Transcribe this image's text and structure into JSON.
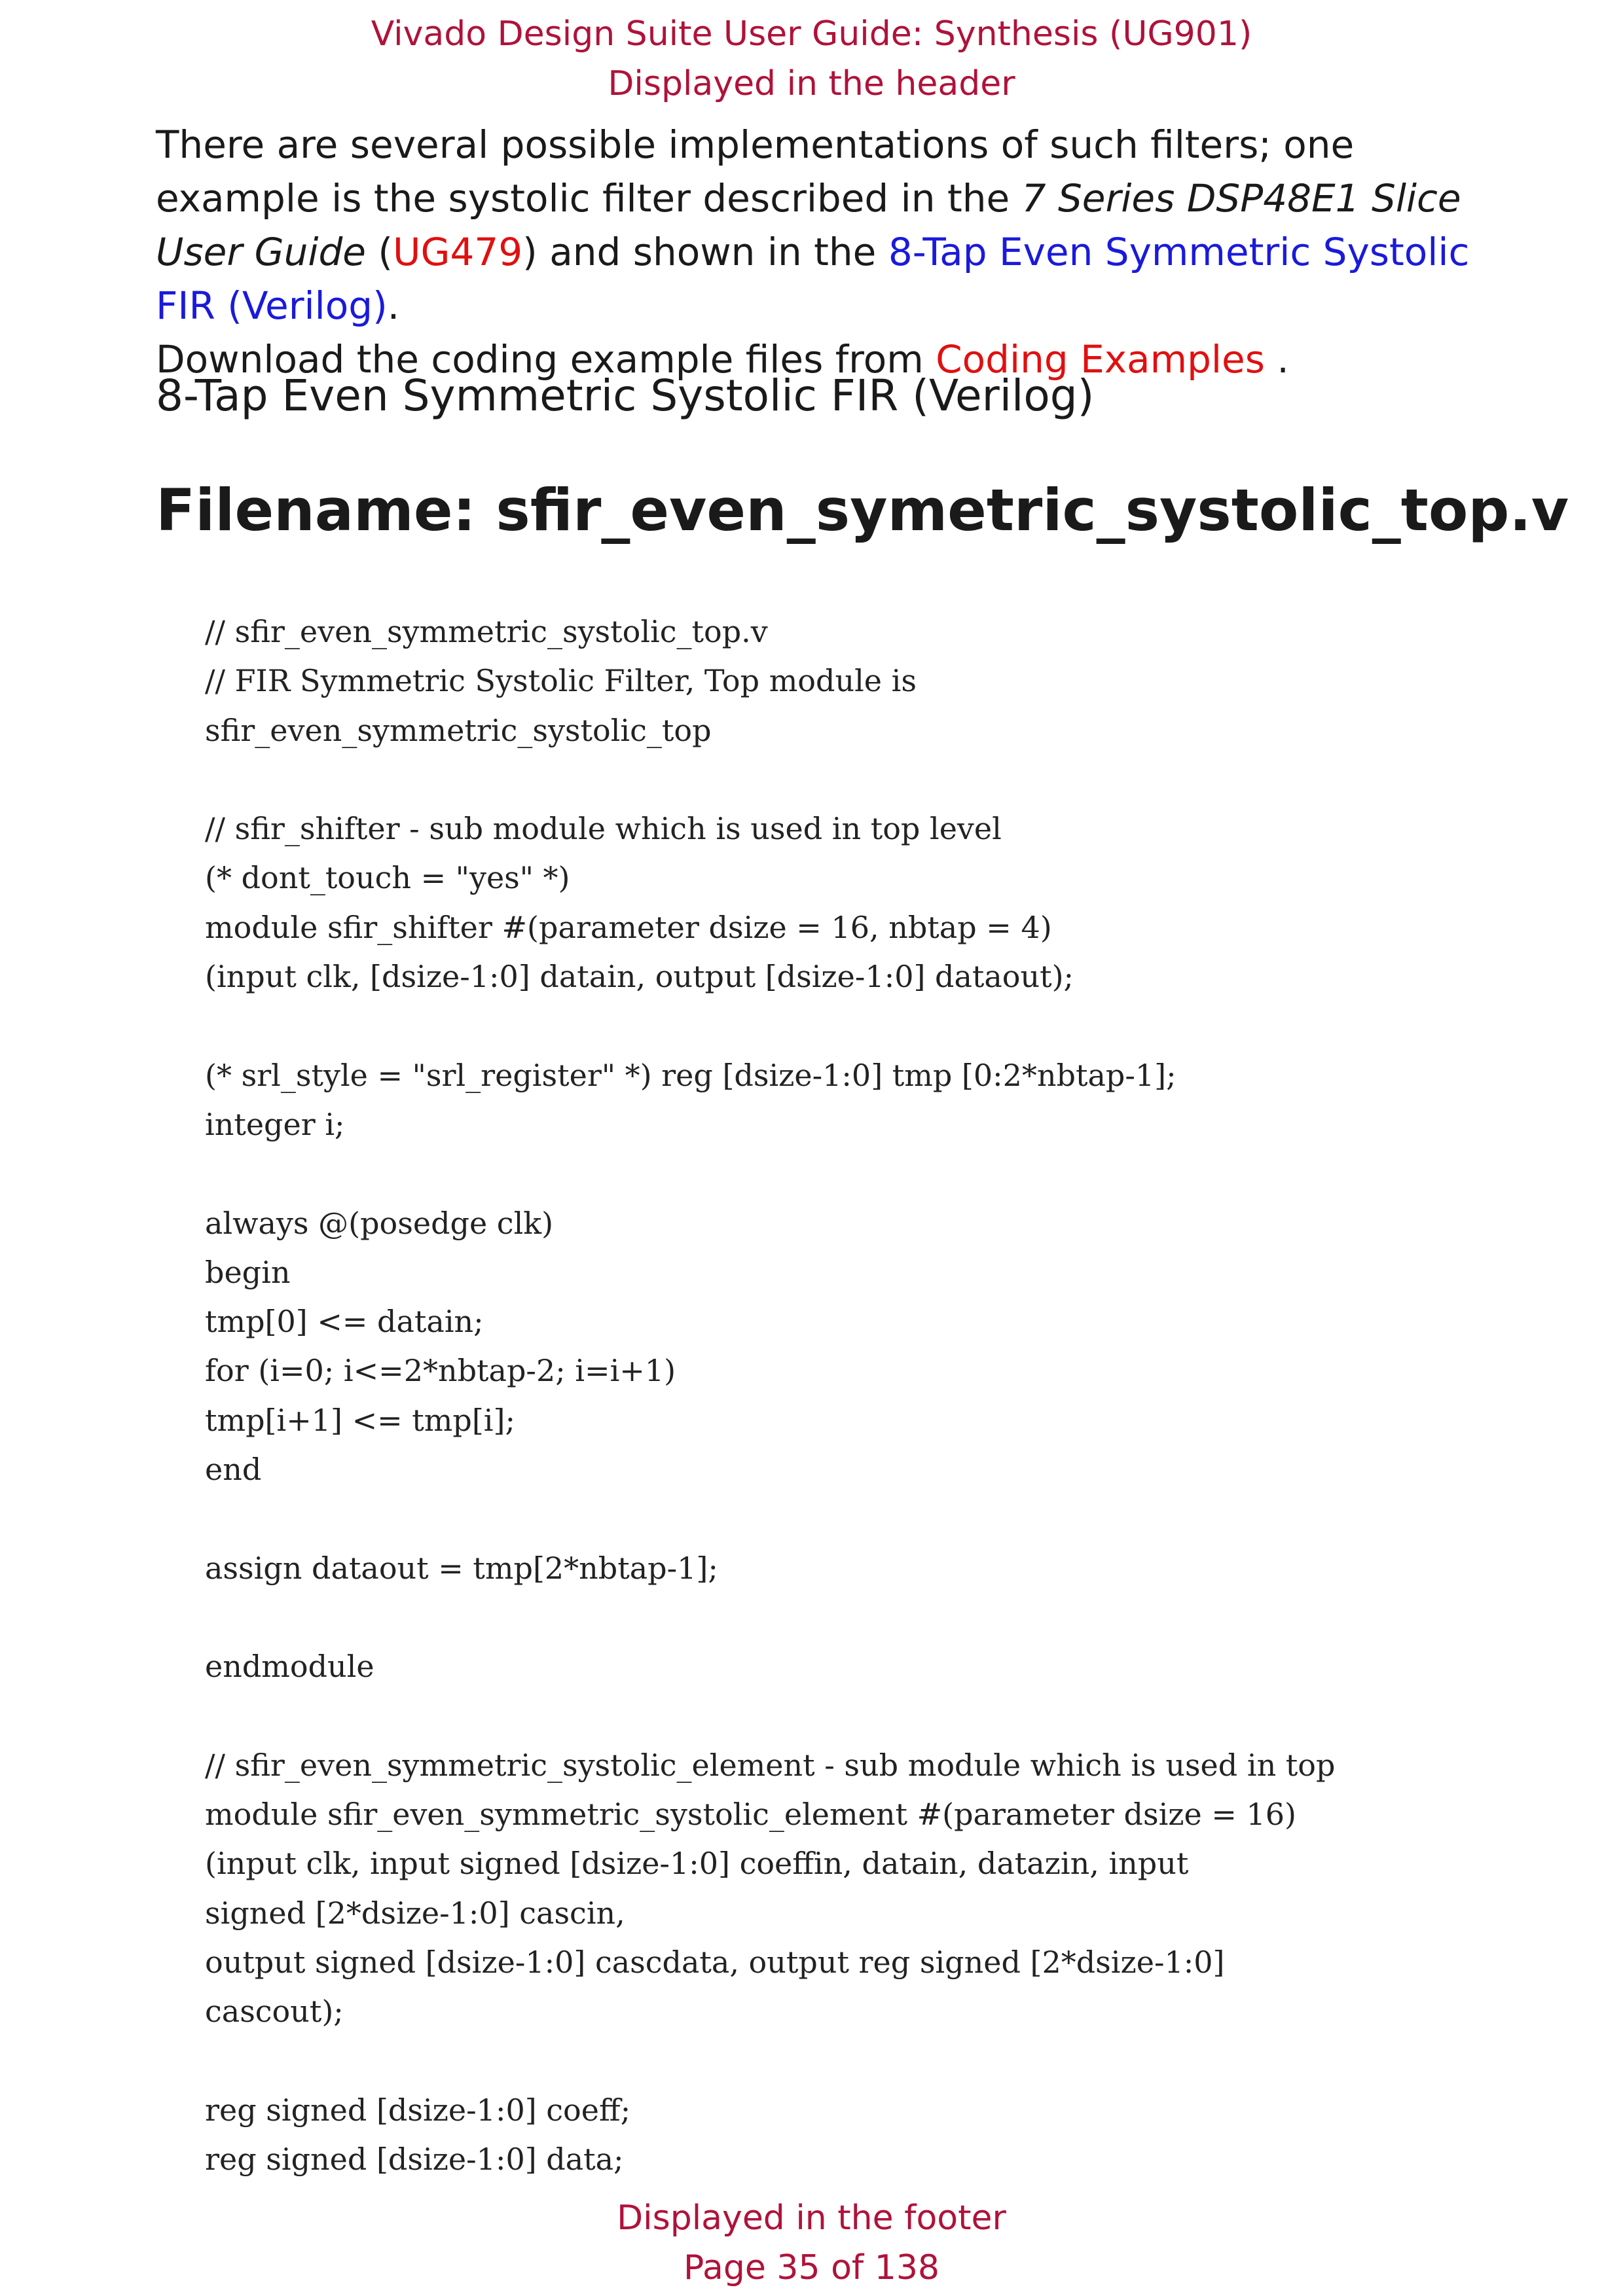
{
  "header": {
    "line1": "Vivado Design Suite User Guide: Synthesis (UG901)",
    "line2": "Displayed in the header"
  },
  "intro": {
    "p1_a": "There are several possible implementations of such filters; one example is the systolic filter described in the ",
    "p1_italic": "7 Series DSP48E1 Slice User Guide",
    "p1_b": " (",
    "p1_link_ug": "UG479",
    "p1_c": ") and shown in the ",
    "p1_link_example": "8-Tap Even Symmetric Systolic FIR (Verilog)",
    "p1_d": ".",
    "p2_a": "Download the coding example files from ",
    "p2_link": "Coding Examples",
    "p2_b": " ."
  },
  "section_heading": "8-Tap Even Symmetric Systolic FIR (Verilog)",
  "filename": "Filename: sfir_even_symetric_systolic_top.v",
  "code_lines": [
    "// sfir_even_symmetric_systolic_top.v",
    "// FIR Symmetric Systolic Filter, Top module is",
    "sfir_even_symmetric_systolic_top",
    "",
    "// sfir_shifter - sub module which is used in top level",
    "(* dont_touch = \"yes\" *)",
    "module sfir_shifter #(parameter dsize = 16, nbtap = 4)",
    "(input clk, [dsize-1:0] datain, output [dsize-1:0] dataout);",
    "",
    "(* srl_style = \"srl_register\" *) reg [dsize-1:0] tmp [0:2*nbtap-1];",
    "integer i;",
    "",
    "always @(posedge clk)",
    "begin",
    "tmp[0] <= datain;",
    "for (i=0; i<=2*nbtap-2; i=i+1)",
    "tmp[i+1] <= tmp[i];",
    "end",
    "",
    "assign dataout = tmp[2*nbtap-1];",
    "",
    "endmodule",
    "",
    "// sfir_even_symmetric_systolic_element - sub module which is used in top",
    "module sfir_even_symmetric_systolic_element #(parameter dsize = 16)",
    "(input clk, input signed [dsize-1:0] coeffin, datain, datazin, input",
    "signed [2*dsize-1:0] cascin,",
    "output signed [dsize-1:0] cascdata, output reg signed [2*dsize-1:0]",
    "cascout);",
    "",
    "reg signed [dsize-1:0] coeff;",
    "reg signed [dsize-1:0] data;"
  ],
  "footer": {
    "line1": "Displayed in the footer",
    "line2": "Page 35 of 138"
  }
}
